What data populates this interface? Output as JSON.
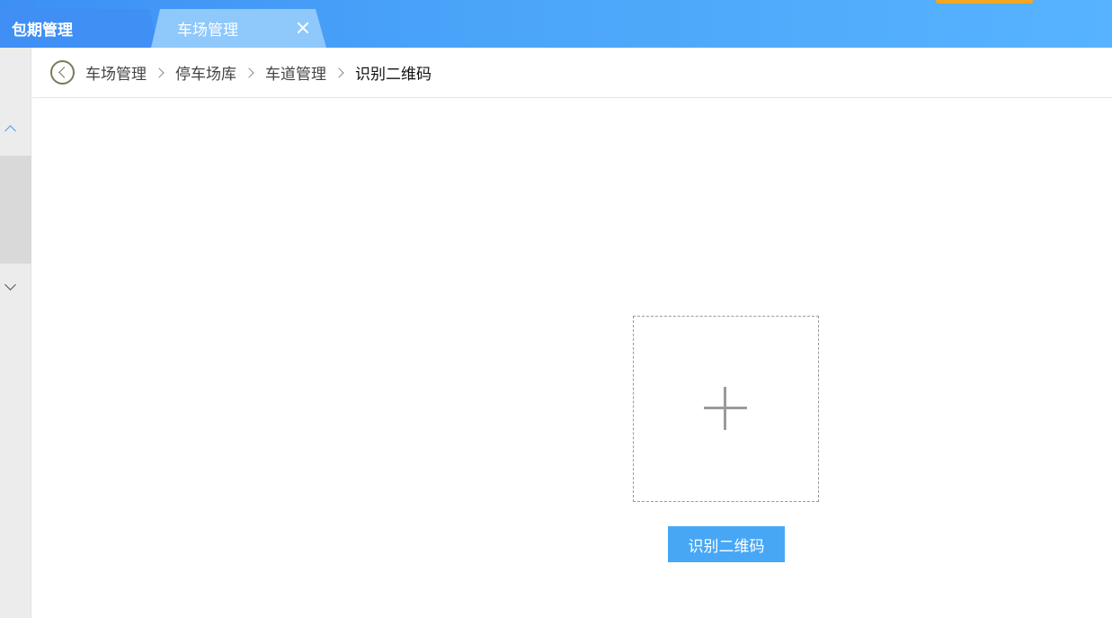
{
  "tabs": [
    {
      "label": "包期管理",
      "active": true
    },
    {
      "label": "车场管理",
      "active": false
    }
  ],
  "breadcrumb": {
    "items": [
      "车场管理",
      "停车场库",
      "车道管理",
      "识别二维码"
    ]
  },
  "upload": {
    "icon": "plus-icon"
  },
  "actions": {
    "recognize_label": "识别二维码"
  },
  "colors": {
    "header": "#4aa3f8",
    "accent": "#f5a623",
    "button": "#47a7f5"
  }
}
